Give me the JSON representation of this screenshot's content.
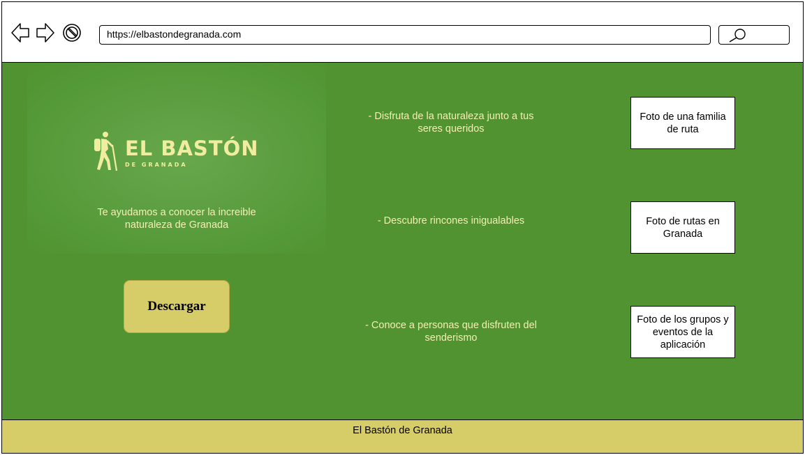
{
  "browser": {
    "url": "https://elbastondegranada.com",
    "back_icon": "arrow-left-outline-icon",
    "forward_icon": "arrow-right-outline-icon",
    "stop_icon": "no-entry-icon",
    "search_icon": "magnifier-icon"
  },
  "hero": {
    "logo_title": "EL BASTÓN",
    "logo_subtitle": "DE GRANADA",
    "logo_icon": "hiker-icon",
    "tagline": "Te ayudamos a conocer la increible naturaleza de Granada",
    "download_label": "Descargar"
  },
  "features": [
    {
      "text": "- Disfruta de la naturaleza junto a tus seres queridos",
      "photo": "Foto de una familia de ruta"
    },
    {
      "text": "- Descubre rincones inigualables",
      "photo": "Foto de rutas en Granada"
    },
    {
      "text": "- Conoce a personas que disfruten del senderismo",
      "photo": "Foto de los grupos y eventos de la aplicación"
    }
  ],
  "footer": {
    "text": "El Bastón de Granada"
  },
  "colors": {
    "main_green": "#509330",
    "accent_yellow": "#d6cc68",
    "text_cream": "#f3f0b4"
  }
}
